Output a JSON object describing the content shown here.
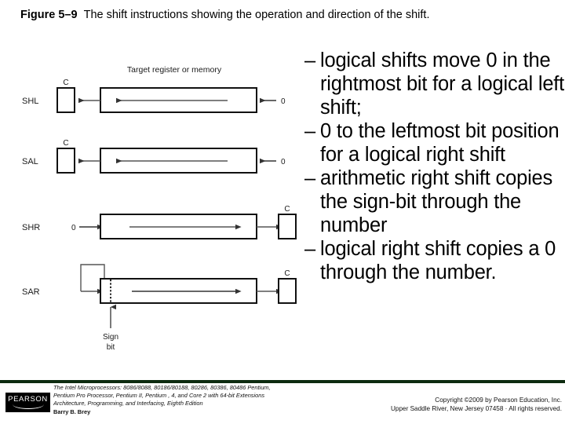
{
  "figure": {
    "label": "Figure 5–9",
    "caption": "The shift instructions showing the operation and direction of the shift.",
    "diagram_caption": "Target register or memory",
    "sign_bit_line1": "Sign",
    "sign_bit_line2": "bit",
    "carry_label": "C",
    "zero_label": "0",
    "rows": [
      {
        "name": "SHL",
        "direction": "left",
        "carry_side": "left",
        "zero_side": "right"
      },
      {
        "name": "SAL",
        "direction": "left",
        "carry_side": "left",
        "zero_side": "right"
      },
      {
        "name": "SHR",
        "direction": "right",
        "carry_side": "right",
        "zero_side": "left"
      },
      {
        "name": "SAR",
        "direction": "right",
        "carry_side": "right",
        "zero_side": "none"
      }
    ]
  },
  "bullets": [
    {
      "dash": "–",
      "text": "logical shifts move 0 in the rightmost bit for a logical left shift;"
    },
    {
      "dash": "–",
      "text": "0 to the leftmost bit position for a logical right shift"
    },
    {
      "dash": "–",
      "text": "arithmetic right shift copies the sign-bit through the number"
    },
    {
      "dash": "–",
      "text": "logical right shift copies a 0 through the number."
    }
  ],
  "footer": {
    "logo_text": "PEARSON",
    "citation_line1": "The Intel Microprocessors: 8086/8088, 80186/80188, 80286, 80386, 80486 Pentium,",
    "citation_line2": "Pentium Pro Processor, Pentium II, Pentium , 4, and Core 2 with 64-bit Extensions",
    "citation_line3": "Architecture, Programming, and Interfacing, Eighth Edition",
    "citation_author": "Barry B. Brey",
    "copyright_line1": "Copyright ©2009 by Pearson Education, Inc.",
    "copyright_line2": "Upper Saddle River, New Jersey 07458 · All rights reserved.",
    "rule_color": "#0d2b10"
  }
}
